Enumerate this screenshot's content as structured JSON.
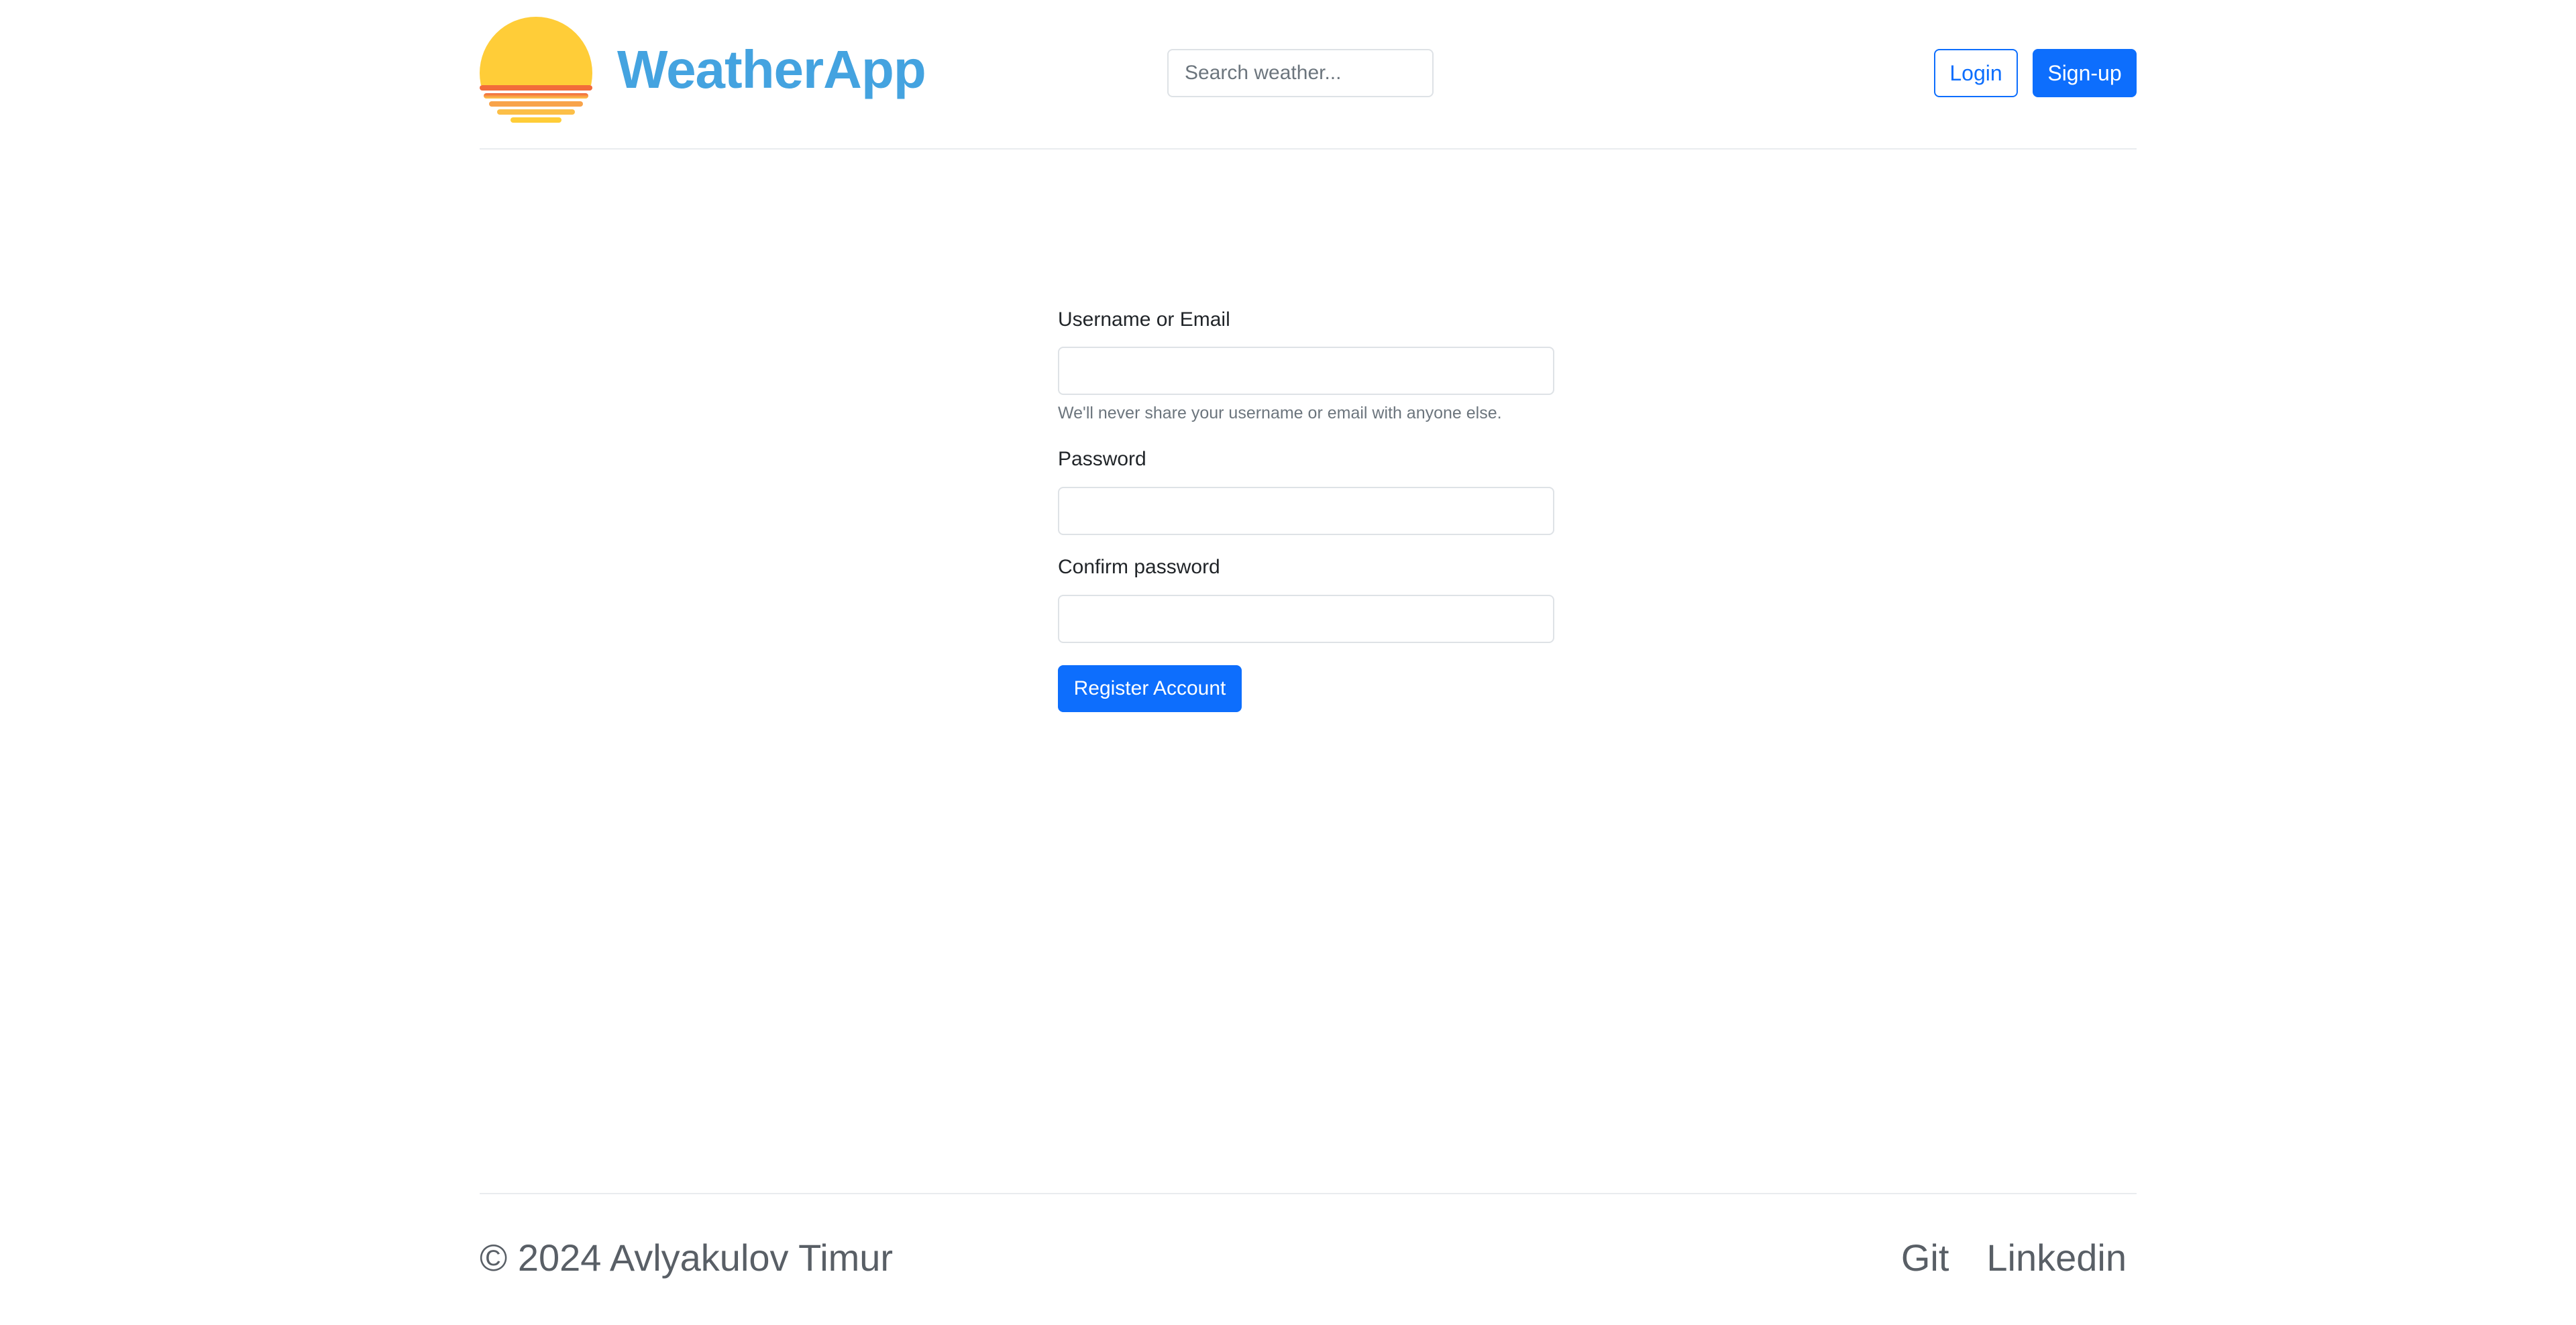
{
  "header": {
    "logo_icon": "sunset-icon",
    "brand": "WeatherApp",
    "search_placeholder": "Search weather...",
    "login_label": "Login",
    "signup_label": "Sign-up"
  },
  "form": {
    "username_label": "Username or Email",
    "username_value": "",
    "username_help": "We'll never share your username or email with anyone else.",
    "password_label": "Password",
    "password_value": "",
    "confirm_label": "Confirm password",
    "confirm_value": "",
    "submit_label": "Register Account"
  },
  "footer": {
    "copyright": "© 2024 Avlyakulov Timur",
    "links": [
      "Git",
      "Linkedin"
    ]
  },
  "colors": {
    "primary": "#0d6efd",
    "brand": "#44a3e0",
    "sun": "#ffcc33",
    "sun_reflection": "#f26b3a"
  }
}
